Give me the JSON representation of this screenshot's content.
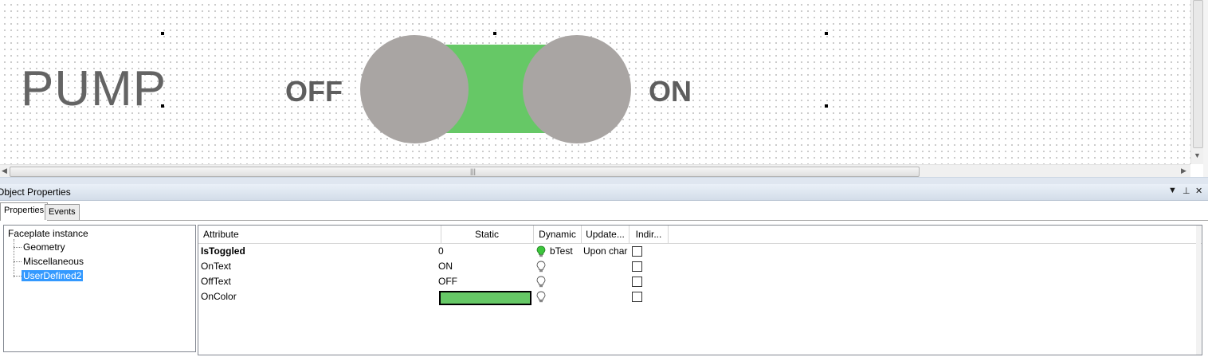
{
  "canvas": {
    "pump_label": "PUMP",
    "off_label": "OFF",
    "on_label": "ON",
    "toggle": {
      "track_color": "#66c866",
      "knob_color": "#a9a5a3"
    }
  },
  "panel": {
    "title": "Object Properties",
    "controls": {
      "dropdown": "▼",
      "pin": "⊥",
      "close": "✕"
    },
    "tabs": [
      "Properties",
      "Events"
    ],
    "tree": {
      "root": "Faceplate instance",
      "items": [
        "Geometry",
        "Miscellaneous",
        "UserDefined2"
      ],
      "selected": "UserDefined2"
    },
    "grid": {
      "columns": [
        "Attribute",
        "Static",
        "Dynamic",
        "Update...",
        "Indir..."
      ],
      "rows": [
        {
          "attribute": "IsToggled",
          "static": "0",
          "dynamic": "bTest",
          "update": "Upon char",
          "bulb": "green",
          "bold": true
        },
        {
          "attribute": "OnText",
          "static": "ON",
          "dynamic": "",
          "update": "",
          "bulb": "outline"
        },
        {
          "attribute": "OffText",
          "static": "OFF",
          "dynamic": "",
          "update": "",
          "bulb": "outline"
        },
        {
          "attribute": "OnColor",
          "static": "",
          "dynamic": "",
          "update": "",
          "bulb": "outline",
          "swatch": "#66c866"
        }
      ]
    }
  },
  "colors": {
    "accent_selection": "#3399ff",
    "title_bar": "#d3dde9",
    "bulb_on": "#3cc63c"
  }
}
